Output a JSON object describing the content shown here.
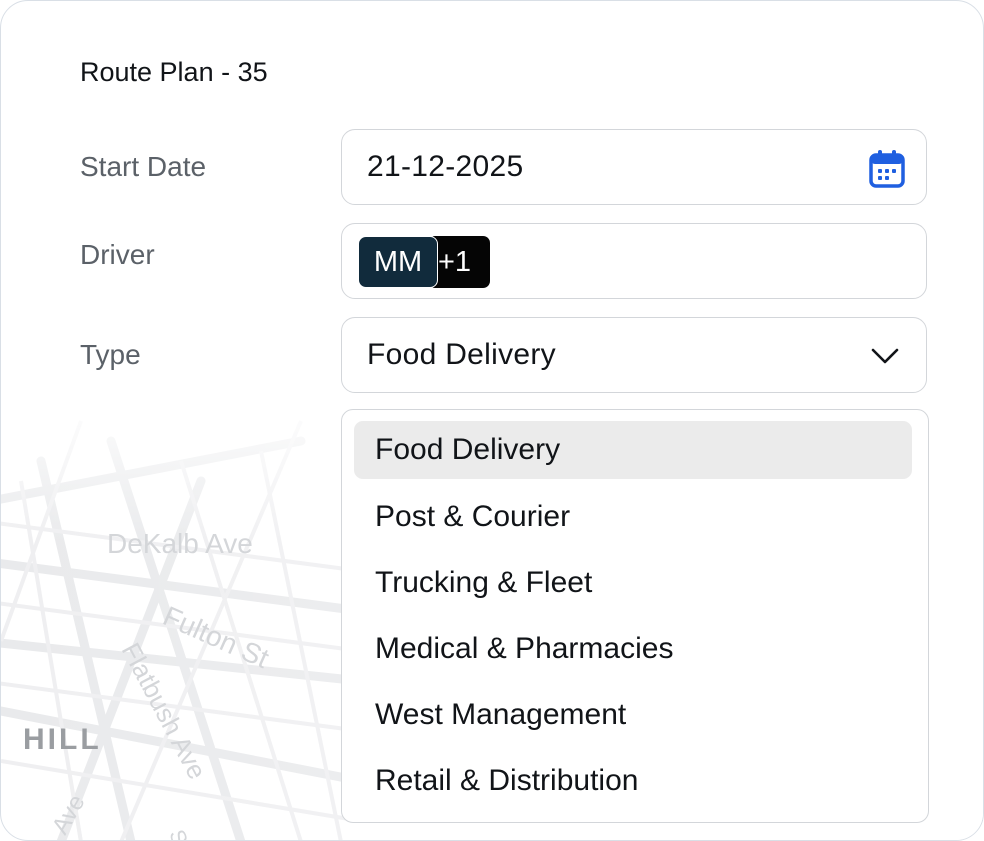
{
  "form": {
    "title": "Route Plan - 35",
    "start_date": {
      "label": "Start Date",
      "value": "21-12-2025",
      "icon": "calendar-icon"
    },
    "driver": {
      "label": "Driver",
      "chips": [
        {
          "initials": "MM"
        }
      ],
      "overflow": "+1"
    },
    "type": {
      "label": "Type",
      "value": "Food Delivery",
      "icon": "chevron-down-icon",
      "options": [
        "Food Delivery",
        "Post & Courier",
        "Trucking & Fleet",
        "Medical & Pharmacies",
        "West Management",
        "Retail & Distribution"
      ],
      "selected_index": 0
    }
  },
  "map": {
    "labels": [
      "DeKalb Ave",
      "Fulton St",
      "Flatbush Ave",
      "HILL",
      "Ave",
      "S"
    ]
  },
  "colors": {
    "accent": "#1f5fe0",
    "chip_primary": "#112b3c",
    "chip_overflow": "#050505",
    "selected_bg": "#ebebeb"
  }
}
